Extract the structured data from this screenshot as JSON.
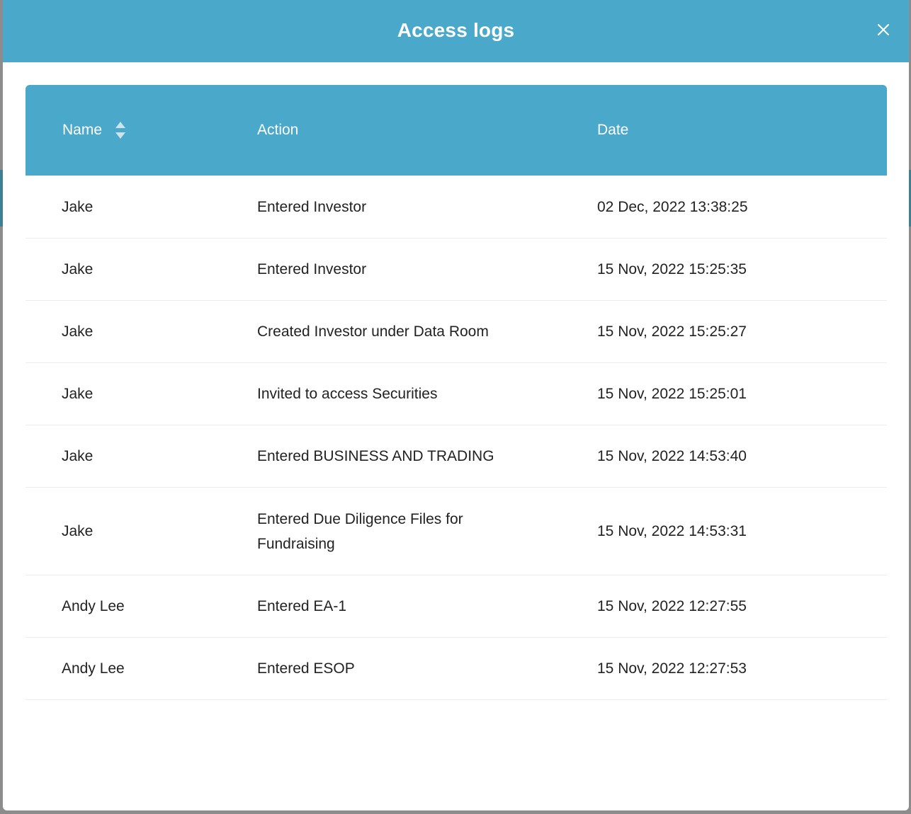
{
  "modal": {
    "title": "Access logs",
    "close_label": "X"
  },
  "table": {
    "columns": {
      "name": "Name",
      "action": "Action",
      "date": "Date"
    },
    "rows": [
      {
        "name": "Jake",
        "action": "Entered Investor",
        "date": "02 Dec, 2022 13:38:25"
      },
      {
        "name": "Jake",
        "action": "Entered Investor",
        "date": "15 Nov, 2022 15:25:35"
      },
      {
        "name": "Jake",
        "action": "Created Investor under Data Room",
        "date": "15 Nov, 2022 15:25:27"
      },
      {
        "name": "Jake",
        "action": "Invited to access Securities",
        "date": "15 Nov, 2022 15:25:01"
      },
      {
        "name": "Jake",
        "action": "Entered BUSINESS AND TRADING",
        "date": "15 Nov, 2022 14:53:40"
      },
      {
        "name": "Jake",
        "action": "Entered Due Diligence Files for Fundraising",
        "date": "15 Nov, 2022 14:53:31"
      },
      {
        "name": "Andy Lee",
        "action": "Entered EA-1",
        "date": "15 Nov, 2022 12:27:55"
      },
      {
        "name": "Andy Lee",
        "action": "Entered ESOP",
        "date": "15 Nov, 2022 12:27:53"
      }
    ]
  },
  "icons": {
    "close": "close-icon",
    "sort": "sort-icon"
  },
  "colors": {
    "accent": "#4aa8cb",
    "header_text": "#ffffff",
    "body_text": "#222222",
    "row_divider": "#ececec"
  }
}
